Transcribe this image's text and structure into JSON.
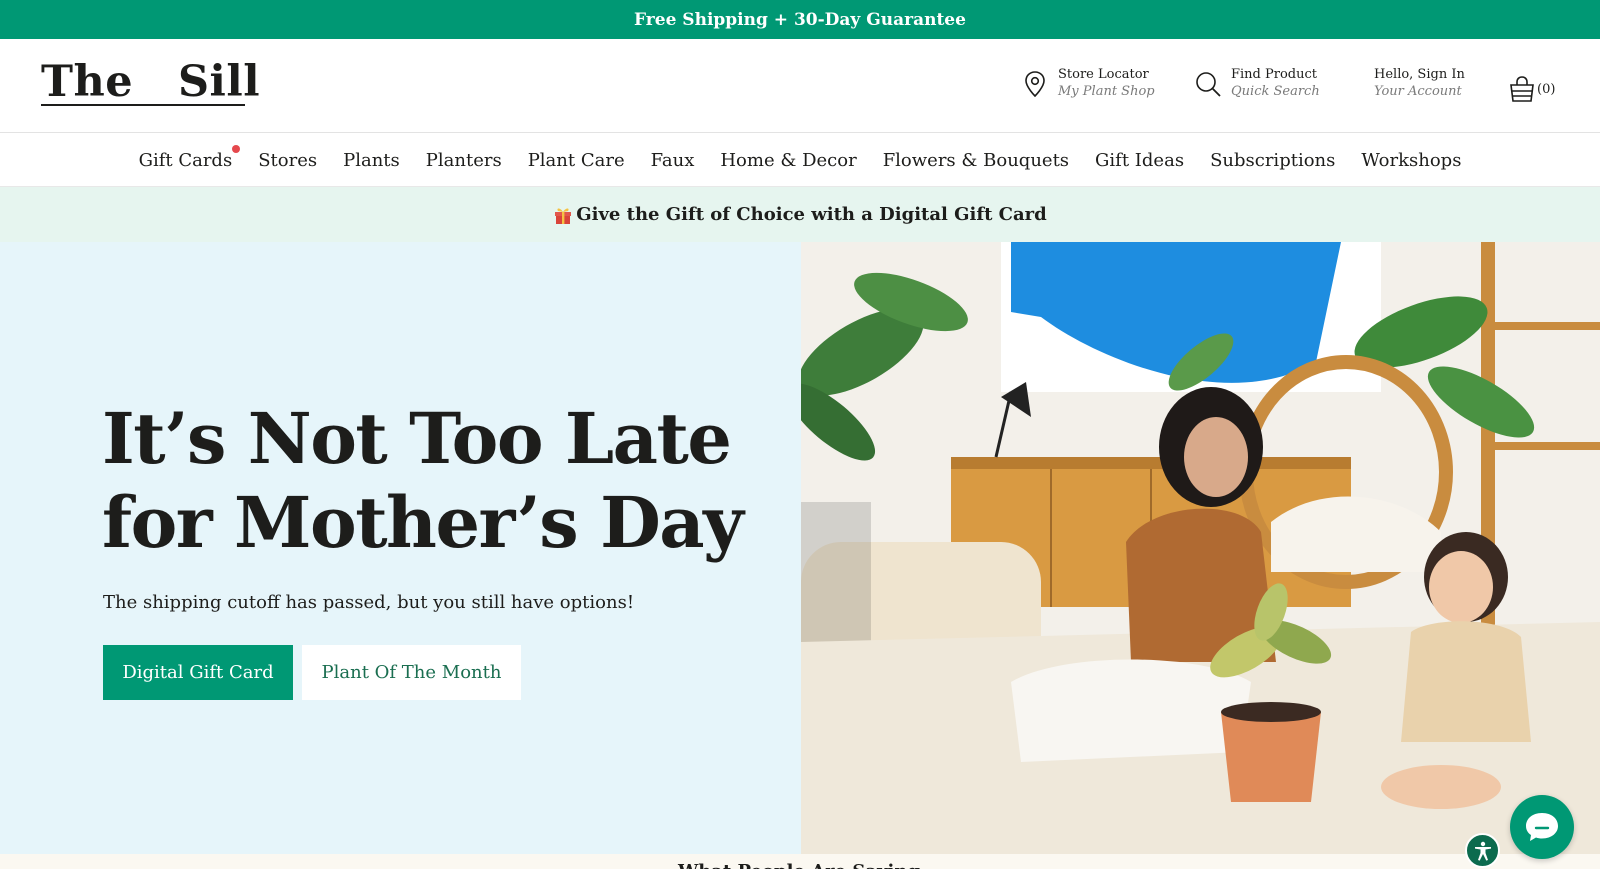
{
  "topbar": {
    "text": "Free Shipping + 30-Day Guarantee"
  },
  "logo": {
    "word1": "The",
    "word2": "Sill"
  },
  "header": {
    "store": {
      "title": "Store Locator",
      "subtitle": "My Plant Shop",
      "icon": "map-pin-icon"
    },
    "find": {
      "title": "Find Product",
      "subtitle": "Quick Search",
      "icon": "search-icon"
    },
    "account": {
      "title": "Hello, Sign In",
      "subtitle": "Your Account"
    },
    "cart": {
      "count": "(0)",
      "icon": "basket-icon"
    }
  },
  "nav": {
    "items": [
      "Gift Cards",
      "Stores",
      "Plants",
      "Planters",
      "Plant Care",
      "Faux",
      "Home & Decor",
      "Flowers & Bouquets",
      "Gift Ideas",
      "Subscriptions",
      "Workshops"
    ],
    "badge_color": "#e5484d"
  },
  "promo": {
    "text": "Give the Gift of Choice with a Digital Gift Card",
    "icon": "gift-icon"
  },
  "hero": {
    "title_line1": "It’s Not Too Late",
    "title_line2": "for Mother’s Day",
    "subtitle": "The shipping cutoff has passed, but you still have options!",
    "primary_button": "Digital Gift Card",
    "secondary_button": "Plant Of The Month",
    "image_alt": "Mother and toddler repotting a plant on a rug"
  },
  "below": {
    "heading_partial": "What People Are Saying"
  },
  "widgets": {
    "chat_icon": "chat-bubble-icon",
    "accessibility_icon": "accessibility-icon"
  },
  "colors": {
    "brand_green": "#009874",
    "hero_bg": "#e6f5fa",
    "promo_bg": "#e6f5ef"
  }
}
